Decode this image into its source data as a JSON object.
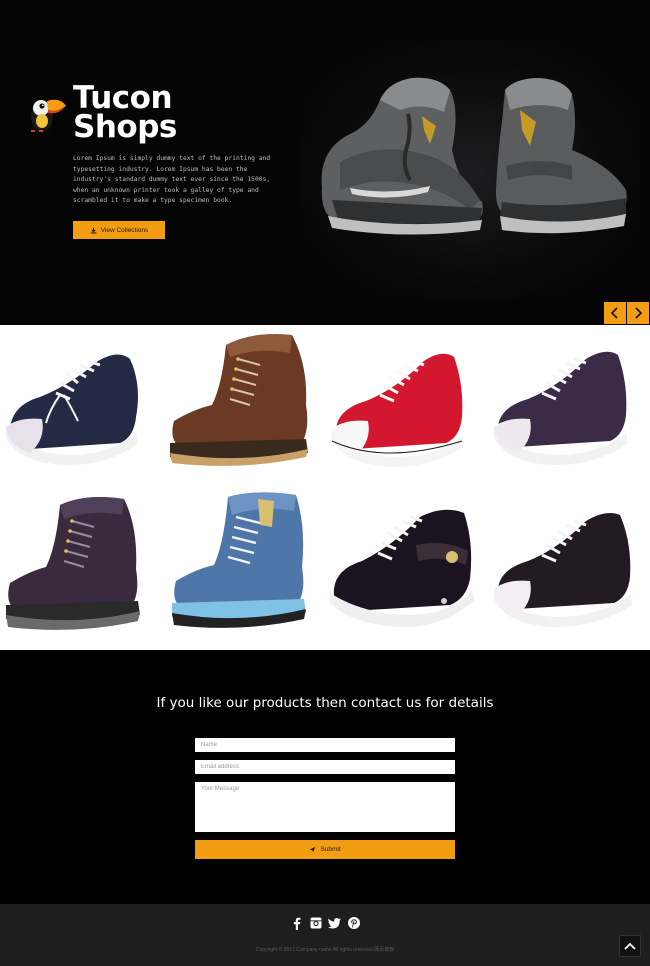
{
  "hero": {
    "brand_line1": "Tucon",
    "brand_line2": "Shops",
    "description": "Lorem Ipsum is simply dummy text of the printing and typesetting industry. Lorem Ipsum has been the industry's standard dummy text ever since the 1500s, when an unknown printer took a galley of type and scrambled it to make a type specimen book.",
    "button_label": "View Collections",
    "icons": {
      "logo": "toucan-logo",
      "button": "download-icon",
      "prev": "chevron-left-icon",
      "next": "chevron-right-icon"
    }
  },
  "gallery": {
    "items": [
      {
        "name": "navy low-top sneaker"
      },
      {
        "name": "brown leather boot"
      },
      {
        "name": "red low-top sneaker"
      },
      {
        "name": "purple low-top sneaker"
      },
      {
        "name": "dark purple boot"
      },
      {
        "name": "blue suede boot"
      },
      {
        "name": "black leather sneaker"
      },
      {
        "name": "black low-top sneaker"
      }
    ]
  },
  "contact": {
    "title": "If you like our products then contact us for details",
    "name_placeholder": "Name",
    "email_placeholder": "Email address",
    "message_placeholder": "Your Message",
    "submit_label": "Submit"
  },
  "footer": {
    "social": [
      "facebook-icon",
      "instagram-icon",
      "twitter-icon",
      "pinterest-icon"
    ],
    "copyright": "Copyright © 2017 Company name All rights reserved.网页模板"
  },
  "colors": {
    "accent": "#f29d12",
    "background": "#000000",
    "footer": "#1e1e1e"
  }
}
